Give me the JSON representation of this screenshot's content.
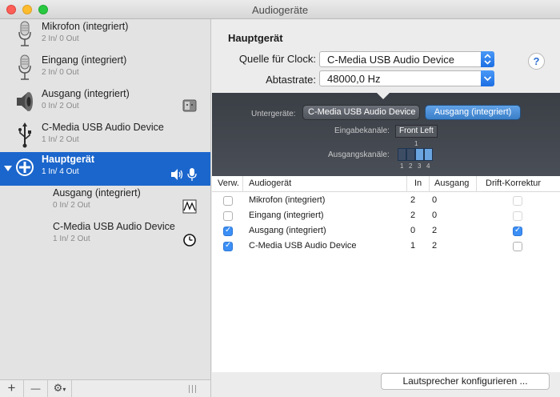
{
  "window": {
    "title": "Audiogeräte"
  },
  "sidebar": {
    "devices": [
      {
        "name": "Mikrofon (integriert)",
        "channels": "2 In/ 0 Out",
        "icon": "microphone-icon"
      },
      {
        "name": "Eingang (integriert)",
        "channels": "2 In/ 0 Out",
        "icon": "microphone-icon"
      },
      {
        "name": "Ausgang (integriert)",
        "channels": "0 In/ 2 Out",
        "icon": "speaker-icon"
      },
      {
        "name": "C-Media USB Audio Device",
        "channels": "1 In/ 2 Out",
        "icon": "usb-icon"
      },
      {
        "name": "Hauptgerät",
        "channels": "1 In/ 4 Out",
        "icon": "aggregate-plus-icon",
        "selected": true
      },
      {
        "name": "Ausgang (integriert)",
        "channels": "0 In/ 2 Out",
        "icon": "waveform-icon"
      },
      {
        "name": "C-Media USB Audio Device",
        "channels": "1 In/ 2 Out",
        "icon": "clock-icon"
      }
    ],
    "toolbar": {
      "add": "+",
      "remove": "—",
      "gear": "⚙"
    }
  },
  "main": {
    "heading": "Hauptgerät",
    "clock_label": "Quelle für Clock:",
    "clock_value": "C-Media USB Audio Device",
    "rate_label": "Abtastrate:",
    "rate_value": "48000,0 Hz",
    "help": "?",
    "subdevices": {
      "label": "Untergeräte:",
      "items": [
        "C-Media USB Audio Device",
        "Ausgang (integriert)"
      ],
      "input_label": "Eingabekanäle:",
      "input_tag": "Front Left",
      "input_channel": "1",
      "output_label": "Ausgangskanäle:",
      "output_channels": [
        "1",
        "2",
        "3",
        "4"
      ]
    },
    "table": {
      "headers": [
        "Verw.",
        "Audiogerät",
        "In",
        "Ausgang",
        "Drift-Korrektur"
      ],
      "rows": [
        {
          "use": false,
          "name": "Mikrofon (integriert)",
          "in": "2",
          "out": "0",
          "drift": false
        },
        {
          "use": false,
          "name": "Eingang (integriert)",
          "in": "2",
          "out": "0",
          "drift": false
        },
        {
          "use": true,
          "name": "Ausgang (integriert)",
          "in": "0",
          "out": "2",
          "drift": true
        },
        {
          "use": true,
          "name": "C-Media USB Audio Device",
          "in": "1",
          "out": "2",
          "drift": false
        }
      ]
    },
    "configure_button": "Lautsprecher konfigurieren ..."
  }
}
